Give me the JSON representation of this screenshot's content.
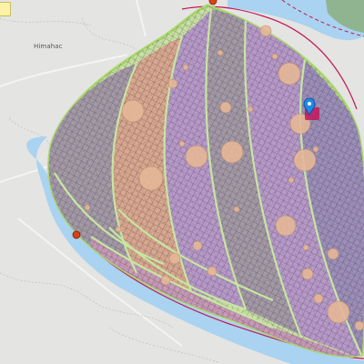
{
  "map": {
    "place_label": "Himahac",
    "colors": {
      "land": "#e4e4e2",
      "water": "#a9d3f0",
      "river_border": "#c2185b",
      "forest": "#8fb48f",
      "field_outline": "#a9d86a",
      "crop_purple": "#b79ac8",
      "crop_peach": "#d9a88e",
      "crop_gray": "#a49aa6",
      "grid_line": "#3b2f47",
      "dots": "#e6b898",
      "marker_blue": "#1e88e5",
      "marker_magenta": "#c2185b",
      "point_red": "#d84315"
    },
    "icons": [
      "location-pin-icon"
    ]
  }
}
